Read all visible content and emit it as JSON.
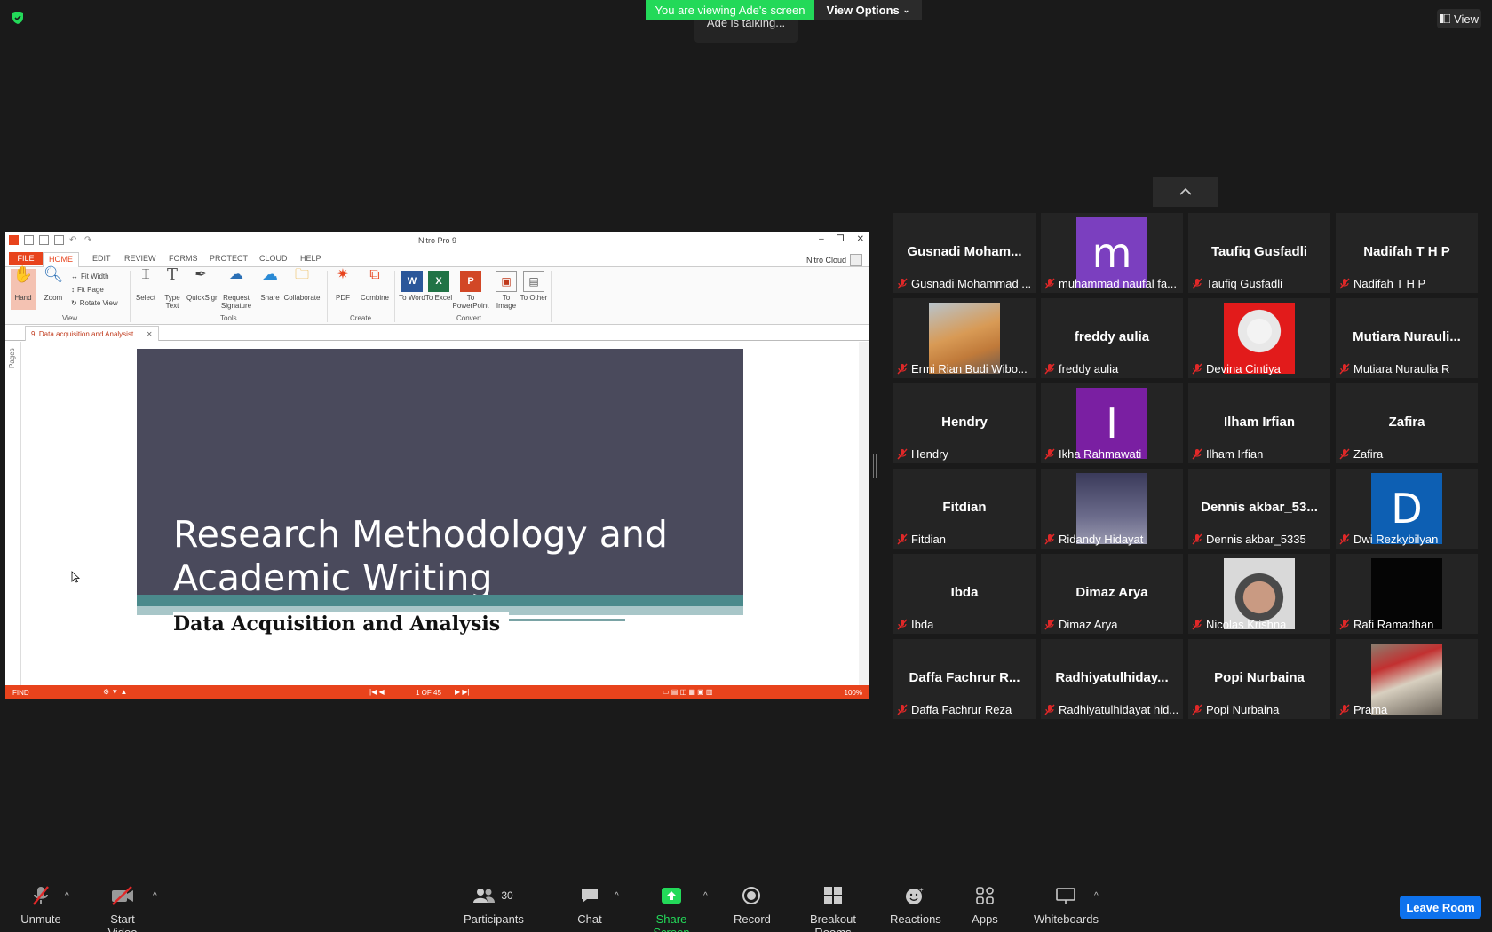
{
  "top": {
    "viewing_banner": "You are viewing Ade's screen",
    "view_options": "View Options",
    "talking": "Ade is talking...",
    "view_button": "View"
  },
  "nitro": {
    "app_title": "Nitro Pro 9",
    "tabs": [
      "FILE",
      "HOME",
      "EDIT",
      "REVIEW",
      "FORMS",
      "PROTECT",
      "CLOUD",
      "HELP"
    ],
    "cloud_label": "Nitro Cloud",
    "ribbon": {
      "hand": "Hand",
      "zoom": "Zoom",
      "fit_width": "Fit Width",
      "fit_page": "Fit Page",
      "rotate_view": "Rotate View",
      "view_group": "View",
      "select": "Select",
      "type_text": "Type Text",
      "quicksign": "QuickSign",
      "request_signature": "Request Signature",
      "share": "Share",
      "collaborate": "Collaborate",
      "tools_group": "Tools",
      "pdf": "PDF",
      "combine": "Combine",
      "create_group": "Create",
      "to_word": "To Word",
      "to_excel": "To Excel",
      "to_powerpoint": "To PowerPoint",
      "to_image": "To Image",
      "to_other": "To Other",
      "convert_group": "Convert"
    },
    "doc_tab": "9. Data acquisition and Analysist...",
    "pages_label": "Pages",
    "slide": {
      "title": "Research Methodology and Academic Writing",
      "subtitle": "Data Acquisition and Analysis"
    },
    "status": {
      "find": "FIND",
      "page": "1 OF 45",
      "zoom": "100%"
    }
  },
  "participants": [
    {
      "big": "Gusnadi  Moham...",
      "name": "Gusnadi Mohammad ..."
    },
    {
      "avatar": "m",
      "avatar_color": "#7b3fbf",
      "name": "muhammad naufal fa..."
    },
    {
      "big": "Taufiq Gusfadli",
      "name": "Taufiq Gusfadli"
    },
    {
      "big": "Nadifah T H P",
      "name": "Nadifah T H P"
    },
    {
      "photo": "cat",
      "name": "Ermi Rian Budi Wibo..."
    },
    {
      "big": "freddy aulia",
      "name": "freddy aulia"
    },
    {
      "photo": "person-red",
      "name": "Devina Cintiya"
    },
    {
      "big": "Mutiara  Nurauli...",
      "name": "Mutiara Nuraulia R"
    },
    {
      "big": "Hendry",
      "name": "Hendry"
    },
    {
      "avatar": "I",
      "avatar_color": "#7a1fa2",
      "name": "Ikha Rahmawati"
    },
    {
      "big": "Ilham Irfian",
      "name": "Ilham Irfian"
    },
    {
      "big": "Zafira",
      "name": "Zafira"
    },
    {
      "big": "Fitdian",
      "name": "Fitdian"
    },
    {
      "photo": "dusk",
      "name": "Ridandy Hidayat"
    },
    {
      "big": "Dennis  akbar_53...",
      "name": "Dennis akbar_5335"
    },
    {
      "avatar": "D",
      "avatar_color": "#0d5fb3",
      "name": "Dwi Rezkybilyan"
    },
    {
      "big": "Ibda",
      "name": "Ibda"
    },
    {
      "big": "Dimaz Arya",
      "name": "Dimaz Arya"
    },
    {
      "photo": "face",
      "name": "Nicolas Krishna"
    },
    {
      "photo": "dark",
      "name": "Rafi Ramadhan"
    },
    {
      "big": "Daffa Fachrur R...",
      "name": "Daffa Fachrur Reza"
    },
    {
      "big": "Radhiyatulhiday...",
      "name": "Radhiyatulhidayat hid..."
    },
    {
      "big": "Popi Nurbaina",
      "name": "Popi Nurbaina"
    },
    {
      "photo": "building",
      "name": "Prama"
    }
  ],
  "toolbar": {
    "unmute": "Unmute",
    "start_video": "Start Video",
    "participants": "Participants",
    "participants_count": "30",
    "chat": "Chat",
    "share_screen": "Share Screen",
    "record": "Record",
    "breakout_rooms": "Breakout Rooms",
    "reactions": "Reactions",
    "apps": "Apps",
    "whiteboards": "Whiteboards",
    "leave_room": "Leave Room"
  },
  "colors": {
    "banner_green": "#23d959",
    "nitro_accent": "#e8431c",
    "leave_blue": "#0e72ed",
    "share_green": "#23d959",
    "muted_red": "#e02828"
  }
}
